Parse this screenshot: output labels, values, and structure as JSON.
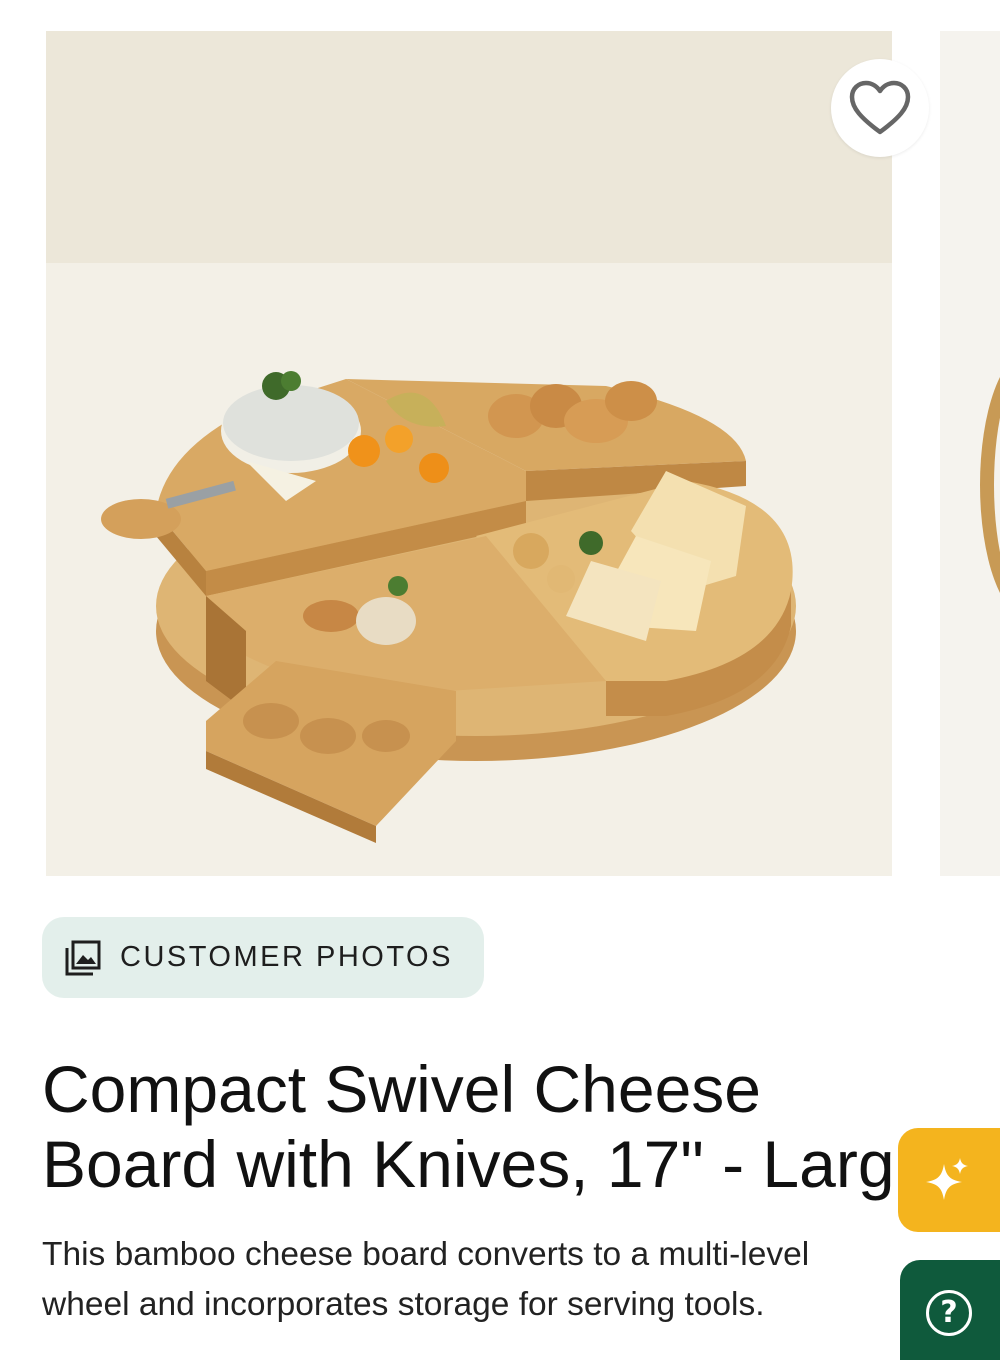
{
  "gallery": {
    "image_alt": "Compact Swivel Cheese Board with Knives",
    "wishlist_icon": "heart-outline-icon"
  },
  "customer_photos": {
    "label": "CUSTOMER PHOTOS",
    "icon": "photo-gallery-icon"
  },
  "product": {
    "title_line1": "Compact Swivel Cheese",
    "title_line2": "Board with Knives, 17\" - Larg",
    "description_line1": "This bamboo cheese board converts to a multi-level",
    "description_line2": "wheel and incorporates storage for serving tools."
  },
  "floating": {
    "ai_icon": "sparkle-icon",
    "help_label": "?"
  },
  "colors": {
    "chip_bg": "#e3efeb",
    "ai_button": "#f4b41e",
    "help_button": "#0f5a3c"
  }
}
